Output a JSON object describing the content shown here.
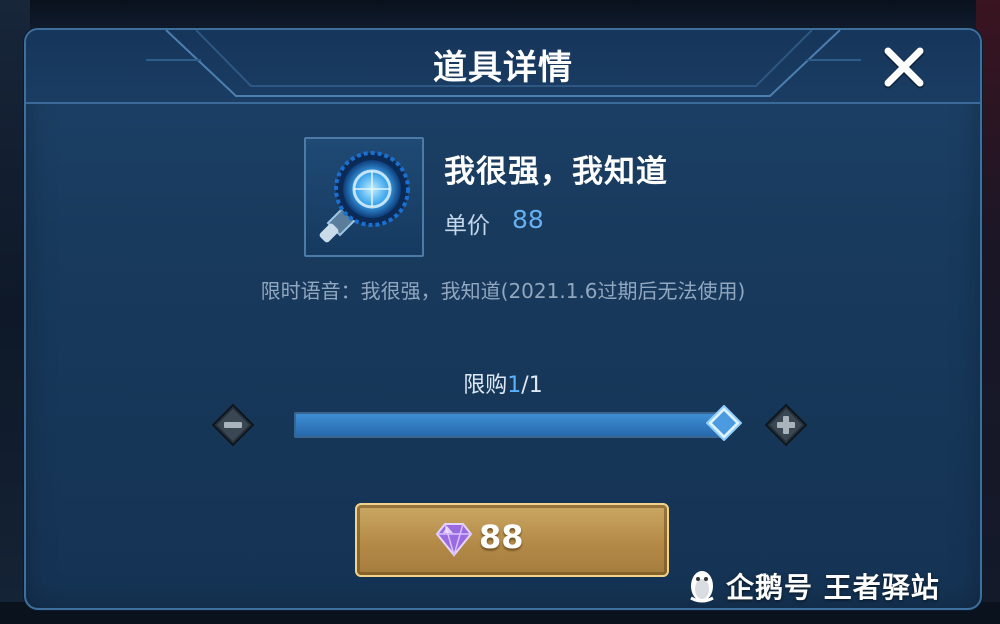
{
  "dialog": {
    "title": "道具详情",
    "close_icon": "close-icon"
  },
  "item": {
    "icon": "speaker-horn-icon",
    "name": "我很强，我知道",
    "price_label": "单价",
    "price_value": "88",
    "description": "限时语音：我很强，我知道(2021.1.6过期后无法使用)"
  },
  "quantity": {
    "limit_label": "限购",
    "current": "1",
    "separator": "/",
    "max": "1",
    "minus_icon": "minus-icon",
    "plus_icon": "plus-icon",
    "slider_fraction": 1.0
  },
  "purchase": {
    "currency_icon": "diamond-gem-icon",
    "price": "88"
  },
  "watermark": {
    "icon": "penguin-icon",
    "text": "企鹅号 王者驿站"
  },
  "colors": {
    "panel": "#183a5d",
    "accent_blue": "#5cb2ff",
    "gold_button": "#b48a48"
  }
}
